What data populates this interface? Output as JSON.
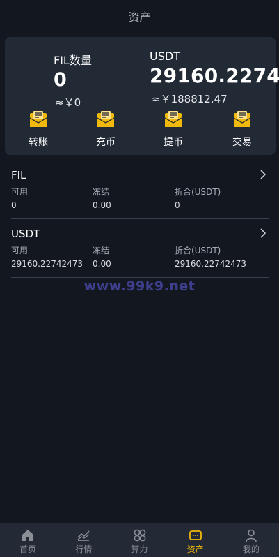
{
  "header": {
    "title": "资产"
  },
  "summary": {
    "fil": {
      "label": "FIL数量",
      "amount": "0",
      "cny": "≈￥0"
    },
    "usdt": {
      "label": "USDT",
      "amount": "29160.2274",
      "cny": "≈￥188812.47"
    }
  },
  "actions": [
    {
      "label": "转账",
      "icon": "envelope-icon"
    },
    {
      "label": "充币",
      "icon": "envelope-icon"
    },
    {
      "label": "提币",
      "icon": "envelope-icon"
    },
    {
      "label": "交易",
      "icon": "envelope-icon"
    }
  ],
  "assets": [
    {
      "name": "FIL",
      "available_label": "可用",
      "available": "0",
      "frozen_label": "冻结",
      "frozen": "0.00",
      "converted_label": "折合(USDT)",
      "converted": "0"
    },
    {
      "name": "USDT",
      "available_label": "可用",
      "available": "29160.22742473",
      "frozen_label": "冻结",
      "frozen": "0.00",
      "converted_label": "折合(USDT)",
      "converted": "29160.22742473"
    }
  ],
  "watermark": "www.99k9.net",
  "tabbar": [
    {
      "label": "首页",
      "icon": "home-icon"
    },
    {
      "label": "行情",
      "icon": "chart-icon"
    },
    {
      "label": "算力",
      "icon": "hashrate-icon"
    },
    {
      "label": "资产",
      "icon": "wallet-icon",
      "active": true
    },
    {
      "label": "我的",
      "icon": "user-icon"
    }
  ],
  "colors": {
    "background": "#131720",
    "card": "#222a36",
    "accent": "#f0b90b",
    "tabbar": "#232a35"
  }
}
